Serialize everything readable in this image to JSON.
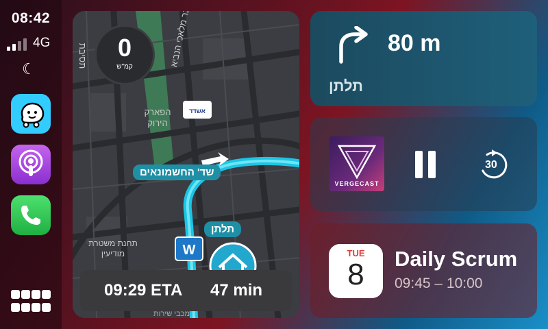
{
  "status": {
    "time": "08:42",
    "network": "4G"
  },
  "apps": [
    {
      "name": "Waze",
      "icon": "waze-icon",
      "color": "#33ccff"
    },
    {
      "name": "Podcasts",
      "icon": "podcasts-icon",
      "color": "#b150e2"
    },
    {
      "name": "Phone",
      "icon": "phone-icon",
      "color": "#34c759"
    }
  ],
  "map": {
    "speed_value": "0",
    "speed_unit": "קמ\"ש",
    "street_current": "שד' החשמונאים",
    "destination_label": "תלתן",
    "eta": "09:29 ETA",
    "duration": "47 min",
    "map_labels": {
      "street_vertical": "כנר מלאכי הנביא",
      "park": "הפארק הירוק",
      "left_street": "תסיבת",
      "police": "תחנת משטרת מודיעין",
      "bottom_street": "מכבי שירות"
    }
  },
  "navigation": {
    "distance": "80 m",
    "street": "תלתן",
    "maneuver_icon": "turn-right-arrow-icon"
  },
  "media": {
    "album_label": "VERGECAST",
    "skip_label": "30"
  },
  "calendar": {
    "month": "TUE",
    "day": "8",
    "event_title": "Daily Scrum",
    "event_time": "09:45 – 10:00"
  }
}
